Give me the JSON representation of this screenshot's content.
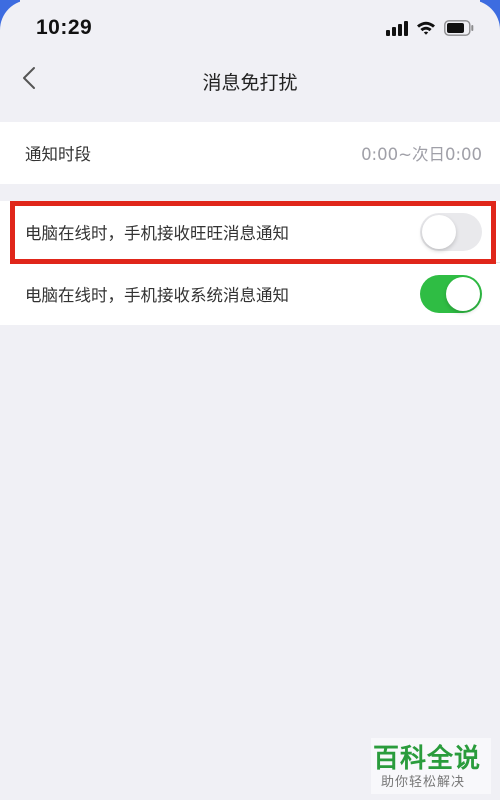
{
  "status_bar": {
    "time": "10:29"
  },
  "nav": {
    "title": "消息免打扰",
    "back_icon": "chevron-left-icon"
  },
  "settings": {
    "notification_period": {
      "label": "通知时段",
      "value": "0:00~次日0:00"
    },
    "wangwang_toggle": {
      "label": "电脑在线时，手机接收旺旺消息通知",
      "on": false
    },
    "system_toggle": {
      "label": "电脑在线时，手机接收系统消息通知",
      "on": true
    }
  },
  "colors": {
    "toggle_on": "#2fbd44",
    "toggle_off": "#e9e9ec",
    "highlight": "#e0261a",
    "background": "#f0f0f5"
  },
  "watermark": {
    "main": "百科全说",
    "sub": "助你轻松解决"
  }
}
